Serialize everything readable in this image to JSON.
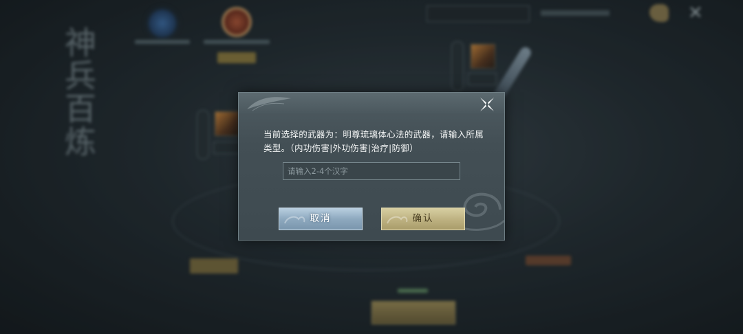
{
  "background": {
    "title": "神兵百炼"
  },
  "dialog": {
    "message": "当前选择的武器为：明尊琉璃体心法的武器，请输入所属类型。（内功伤害|外功伤害|治疗|防御）",
    "input": {
      "value": "",
      "placeholder": "请输入2-4个汉字"
    },
    "buttons": {
      "cancel_label": "取消",
      "confirm_label": "确认"
    }
  },
  "colors": {
    "dialog_bg": "#434f55",
    "cancel_button": "#8ea9bf",
    "confirm_button": "#bfb383"
  },
  "icons": {
    "close": "close-icon"
  }
}
